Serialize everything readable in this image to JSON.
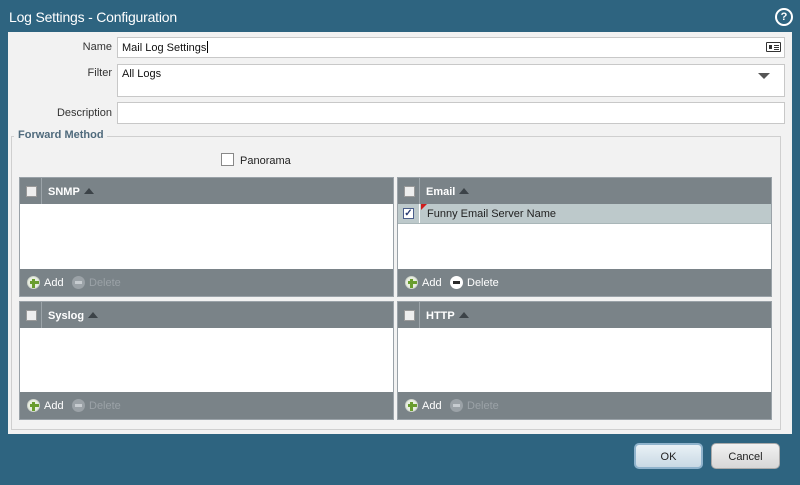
{
  "dialog": {
    "title": "Log Settings - Configuration",
    "help_icon": "?"
  },
  "form": {
    "name_label": "Name",
    "name_value": "Mail Log Settings",
    "filter_label": "Filter",
    "filter_value": "All Logs",
    "description_label": "Description",
    "description_value": ""
  },
  "forward_method": {
    "legend": "Forward Method",
    "panorama_label": "Panorama",
    "panorama_checked": false
  },
  "panels": {
    "snmp": {
      "title": "SNMP",
      "add_label": "Add",
      "delete_label": "Delete",
      "rows": []
    },
    "email": {
      "title": "Email",
      "add_label": "Add",
      "delete_label": "Delete",
      "rows": [
        {
          "name": "Funny Email Server Name",
          "checked": true
        }
      ]
    },
    "syslog": {
      "title": "Syslog",
      "add_label": "Add",
      "delete_label": "Delete",
      "rows": []
    },
    "http": {
      "title": "HTTP",
      "add_label": "Add",
      "delete_label": "Delete",
      "rows": []
    }
  },
  "buttons": {
    "ok_label": "OK",
    "cancel_label": "Cancel"
  },
  "icons": {
    "help": "help-icon",
    "address_card": "address-card-icon",
    "dropdown": "chevron-down-icon",
    "add": "add-icon",
    "delete": "delete-icon",
    "sort": "sort-asc-icon"
  },
  "colors": {
    "titlebar": "#2e6480",
    "panel_header": "#7a8388",
    "selected_row": "#bdc9cb",
    "add_green": "#6a9d2e"
  }
}
